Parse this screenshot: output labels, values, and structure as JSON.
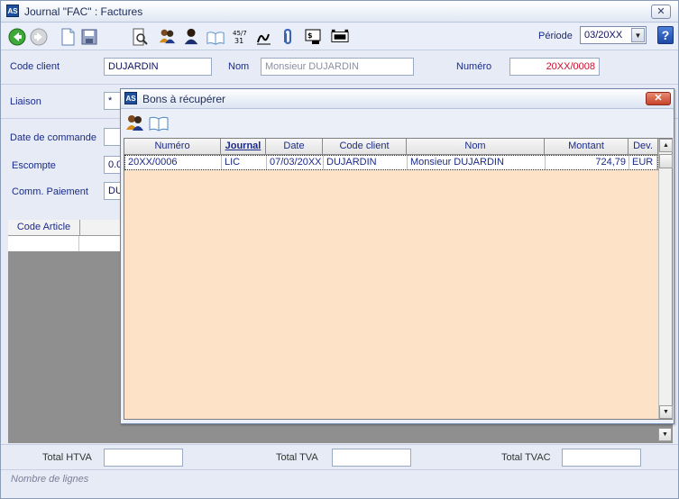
{
  "window": {
    "title": "Journal \"FAC\" : Factures",
    "app_icon": "AS"
  },
  "toolbar": {
    "periode_label": "Période",
    "periode_value": "03/20XX",
    "help": "?"
  },
  "form": {
    "code_client_label": "Code client",
    "code_client_value": "DUJARDIN",
    "nom_label": "Nom",
    "nom_value": "Monsieur DUJARDIN",
    "numero_label": "Numéro",
    "numero_value": "20XX/0008",
    "liaison_label": "Liaison",
    "liaison_value": "*",
    "date_commande_label": "Date de commande",
    "escompte_label": "Escompte",
    "escompte_value": "0.0",
    "comm_paiement_label": "Comm. Paiement",
    "comm_paiement_value": "DU"
  },
  "lines": {
    "code_article_header": "Code Article"
  },
  "footer": {
    "total_htva_label": "Total HTVA",
    "total_tva_label": "Total TVA",
    "total_tvac_label": "Total TVAC",
    "status": "Nombre de lignes"
  },
  "dialog": {
    "title": "Bons à récupérer",
    "columns": [
      "Numéro",
      "Journal",
      "Date",
      "Code client",
      "Nom",
      "Montant",
      "Dev."
    ],
    "rows": [
      [
        "20XX/0006",
        "LIC",
        "07/03/20XX",
        "DUJARDIN",
        "Monsieur DUJARDIN",
        "724,79",
        "EUR"
      ]
    ]
  },
  "colors": {
    "table_bg": "#fde2c8",
    "numero_text": "#c8102e",
    "window_bg": "#e6ebf6"
  }
}
